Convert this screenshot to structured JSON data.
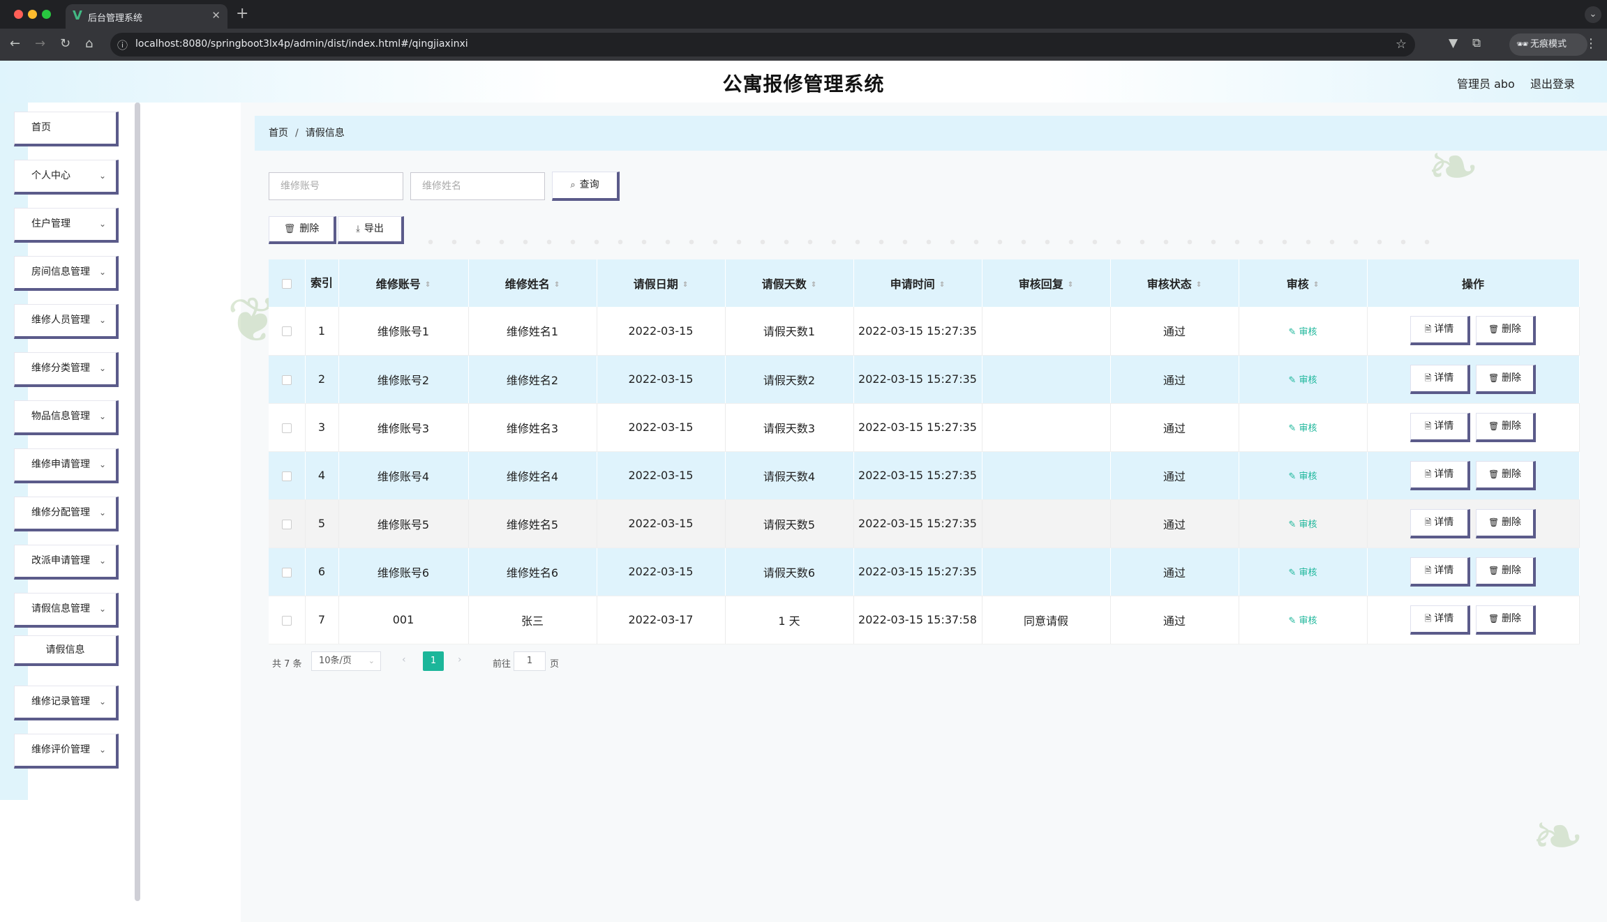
{
  "browser": {
    "tab_title": "后台管理系统",
    "tab_favicon": "V",
    "url": "localhost:8080/springboot3lx4p/admin/dist/index.html#/qingjiaxinxi",
    "incognito_label": "无痕模式"
  },
  "header": {
    "title": "公寓报修管理系统",
    "user": "管理员 abo",
    "logout": "退出登录"
  },
  "sidebar": {
    "items": [
      {
        "label": "首页"
      },
      {
        "label": "个人中心"
      },
      {
        "label": "住户管理"
      },
      {
        "label": "房间信息管理"
      },
      {
        "label": "维修人员管理"
      },
      {
        "label": "维修分类管理"
      },
      {
        "label": "物品信息管理"
      },
      {
        "label": "维修申请管理"
      },
      {
        "label": "维修分配管理"
      },
      {
        "label": "改派申请管理"
      },
      {
        "label": "请假信息管理"
      },
      {
        "label": "请假信息"
      },
      {
        "label": "维修记录管理"
      },
      {
        "label": "维修评价管理"
      }
    ]
  },
  "breadcrumb": {
    "home": "首页",
    "sep": "/",
    "current": "请假信息"
  },
  "search": {
    "account_placeholder": "维修账号",
    "name_placeholder": "维修姓名",
    "query_label": "查询"
  },
  "toolbar": {
    "delete_label": "删除",
    "export_label": "导出"
  },
  "table": {
    "headers": {
      "index": "索引",
      "account": "维修账号",
      "name": "维修姓名",
      "leave_date": "请假日期",
      "days": "请假天数",
      "apply_time": "申请时间",
      "reply": "审核回复",
      "status": "审核状态",
      "audit": "审核",
      "ops": "操作"
    },
    "audit_label": "审核",
    "detail_label": "详情",
    "delete_label": "删除",
    "rows": [
      {
        "index": "1",
        "account": "维修账号1",
        "name": "维修姓名1",
        "leave_date": "2022-03-15",
        "days": "请假天数1",
        "apply_time": "2022-03-15 15:27:35",
        "reply": "",
        "status": "通过"
      },
      {
        "index": "2",
        "account": "维修账号2",
        "name": "维修姓名2",
        "leave_date": "2022-03-15",
        "days": "请假天数2",
        "apply_time": "2022-03-15 15:27:35",
        "reply": "",
        "status": "通过"
      },
      {
        "index": "3",
        "account": "维修账号3",
        "name": "维修姓名3",
        "leave_date": "2022-03-15",
        "days": "请假天数3",
        "apply_time": "2022-03-15 15:27:35",
        "reply": "",
        "status": "通过"
      },
      {
        "index": "4",
        "account": "维修账号4",
        "name": "维修姓名4",
        "leave_date": "2022-03-15",
        "days": "请假天数4",
        "apply_time": "2022-03-15 15:27:35",
        "reply": "",
        "status": "通过"
      },
      {
        "index": "5",
        "account": "维修账号5",
        "name": "维修姓名5",
        "leave_date": "2022-03-15",
        "days": "请假天数5",
        "apply_time": "2022-03-15 15:27:35",
        "reply": "",
        "status": "通过"
      },
      {
        "index": "6",
        "account": "维修账号6",
        "name": "维修姓名6",
        "leave_date": "2022-03-15",
        "days": "请假天数6",
        "apply_time": "2022-03-15 15:27:35",
        "reply": "",
        "status": "通过"
      },
      {
        "index": "7",
        "account": "001",
        "name": "张三",
        "leave_date": "2022-03-17",
        "days": "1 天",
        "apply_time": "2022-03-15 15:37:58",
        "reply": "同意请假",
        "status": "通过"
      }
    ]
  },
  "pagination": {
    "total": "共 7 条",
    "page_size": "10条/页",
    "current": "1",
    "goto_label": "前往",
    "goto_value": "1",
    "page_suffix": "页"
  },
  "colors": {
    "accent": "#1cb69a",
    "header_blue": "#dff3fc",
    "button_border": "#5b5b8a"
  }
}
